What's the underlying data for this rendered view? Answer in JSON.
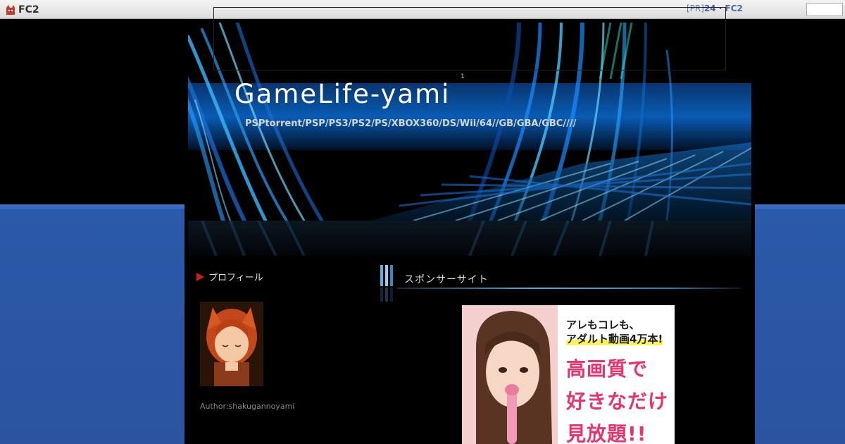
{
  "fc2_bar": {
    "logo_text": "FC2",
    "pr_label": "[PR]",
    "pr_link": "24 · FC2",
    "search_value": ""
  },
  "header": {
    "title": "GameLife-yami",
    "sup": "1",
    "description": "PSPtorrent/PSP/PS3/PS2/PS/XBOX360/DS/Wii/64//GB/GBA/GBC////"
  },
  "sidebar": {
    "profile_heading": "プロフィール",
    "author_text": "Author:shakugannoyami"
  },
  "main": {
    "entry_heading": "スポンサーサイト",
    "ad": {
      "line1": "アレもコレも、",
      "line2": "アダルト動画4万本!",
      "big1": "高画質で",
      "big2": "好きなだけ",
      "big3": "見放題!!"
    }
  },
  "colors": {
    "page_bg": "#000000",
    "band_blue": "#2b5aa8",
    "accent_red": "#d21b1b",
    "ad_pink": "#e6356d"
  }
}
